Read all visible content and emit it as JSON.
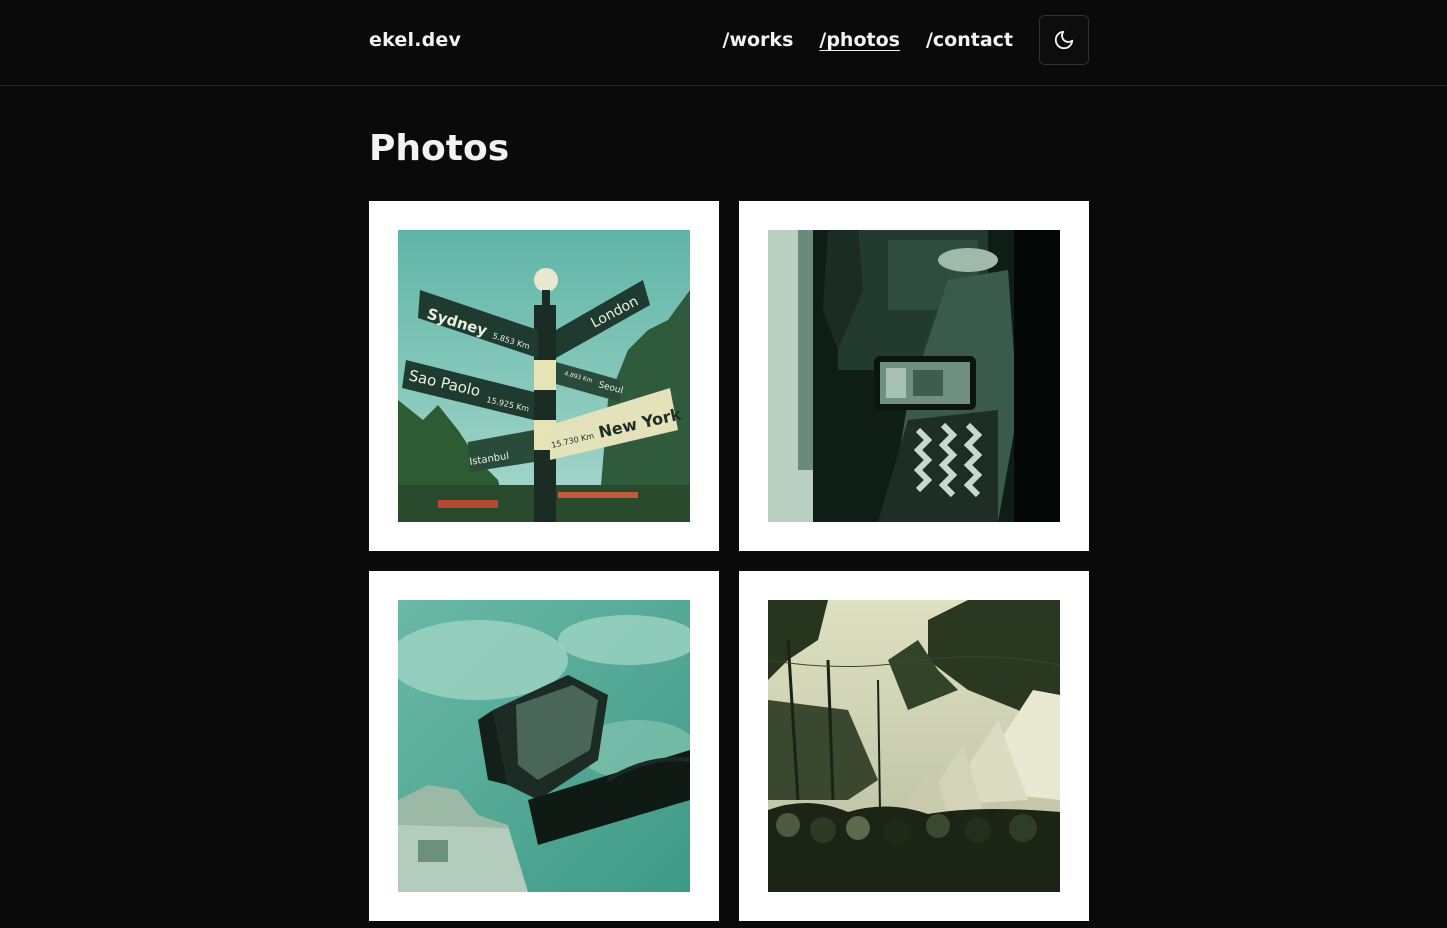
{
  "site": {
    "logo": "ekel.dev"
  },
  "nav": {
    "items": [
      {
        "label": "/works",
        "active": false
      },
      {
        "label": "/photos",
        "active": true
      },
      {
        "label": "/contact",
        "active": false
      }
    ],
    "theme_toggle_icon": "moon-icon"
  },
  "page": {
    "title": "Photos"
  },
  "photos": [
    {
      "subject": "signpost",
      "signs": [
        "Sydney",
        "5.853 Km",
        "London",
        "Sao Paolo",
        "15.925 Km",
        "Seoul",
        "4.893 Km",
        "New York",
        "15.730 Km",
        "Istanbul"
      ]
    },
    {
      "subject": "phone-recording-crowd"
    },
    {
      "subject": "floodlight-against-sky"
    },
    {
      "subject": "market-tents-palm-trees"
    }
  ],
  "colors": {
    "background": "#0a0a0a",
    "text": "#f2f2f2",
    "card": "#ffffff"
  }
}
